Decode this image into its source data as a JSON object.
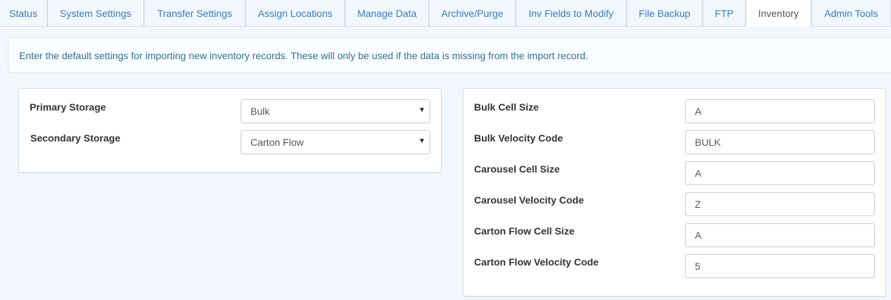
{
  "tabs": [
    {
      "label": "Status",
      "active": false
    },
    {
      "label": "System Settings",
      "active": false
    },
    {
      "label": "Transfer Settings",
      "active": false
    },
    {
      "label": "Assign Locations",
      "active": false
    },
    {
      "label": "Manage Data",
      "active": false
    },
    {
      "label": "Archive/Purge",
      "active": false
    },
    {
      "label": "Inv Fields to Modify",
      "active": false
    },
    {
      "label": "File Backup",
      "active": false
    },
    {
      "label": "FTP",
      "active": false
    },
    {
      "label": "Inventory",
      "active": true
    },
    {
      "label": "Admin Tools",
      "active": false
    }
  ],
  "info_text": "Enter the default settings for importing new inventory records. These will only be used if the data is missing from the import record.",
  "storage": {
    "primary_label": "Primary Storage",
    "primary_value": "Bulk",
    "secondary_label": "Secondary Storage",
    "secondary_value": "Carton Flow"
  },
  "fields": [
    {
      "label": "Bulk Cell Size",
      "value": "A"
    },
    {
      "label": "Bulk Velocity Code",
      "value": "BULK"
    },
    {
      "label": "Carousel Cell Size",
      "value": "A"
    },
    {
      "label": "Carousel Velocity Code",
      "value": "Z"
    },
    {
      "label": "Carton Flow Cell Size",
      "value": "A"
    },
    {
      "label": "Carton Flow Velocity Code",
      "value": "5"
    }
  ],
  "colors": {
    "link": "#3a7bbf",
    "info_text": "#31708f",
    "background": "#f1f7fc"
  }
}
